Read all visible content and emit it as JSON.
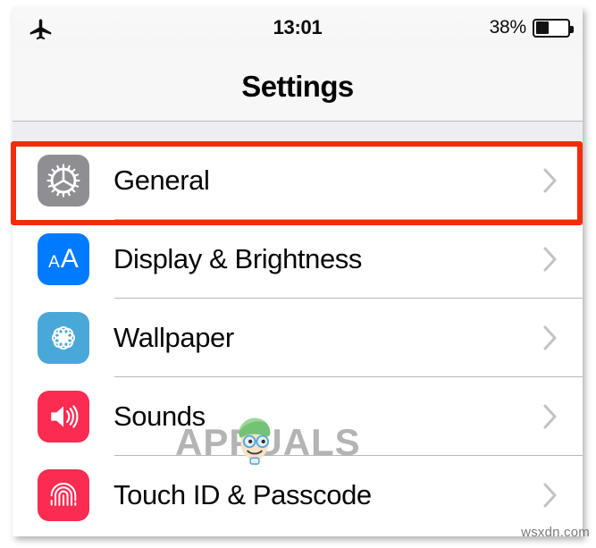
{
  "status_bar": {
    "airplane_icon": "airplane-icon",
    "time": "13:01",
    "battery_percent_label": "38%",
    "battery_level": 38,
    "battery_icon": "battery-icon"
  },
  "nav": {
    "title": "Settings"
  },
  "colors": {
    "highlight": "#f42c0b",
    "icon_general": "#8e8e93",
    "icon_display": "#007aff",
    "icon_wallpaper": "#4aa8d8",
    "icon_sounds": "#fb2b51",
    "icon_touchid": "#fb2b51",
    "separator": "#b9b9bb",
    "group_background": "#eeeef2",
    "status_background": "#f7f7f8"
  },
  "settings_list": [
    {
      "label": "General",
      "icon": "gear-icon",
      "icon_color": "#8e8e93",
      "chevron": "chevron-right-icon",
      "highlighted": true
    },
    {
      "label": "Display & Brightness",
      "icon": "aa-text-size-icon",
      "icon_color": "#007aff",
      "icon_small_letter": "A",
      "icon_large_letter": "A",
      "chevron": "chevron-right-icon",
      "highlighted": false
    },
    {
      "label": "Wallpaper",
      "icon": "flower-rosette-icon",
      "icon_color": "#4aa8d8",
      "chevron": "chevron-right-icon",
      "highlighted": false
    },
    {
      "label": "Sounds",
      "icon": "speaker-volume-icon",
      "icon_color": "#fb2b51",
      "chevron": "chevron-right-icon",
      "highlighted": false
    },
    {
      "label": "Touch ID & Passcode",
      "icon": "fingerprint-icon",
      "icon_color": "#fb2b51",
      "chevron": "chevron-right-icon",
      "highlighted": false
    }
  ],
  "watermarks": {
    "brand": "APPUALS",
    "site": "wsxdn.com"
  }
}
